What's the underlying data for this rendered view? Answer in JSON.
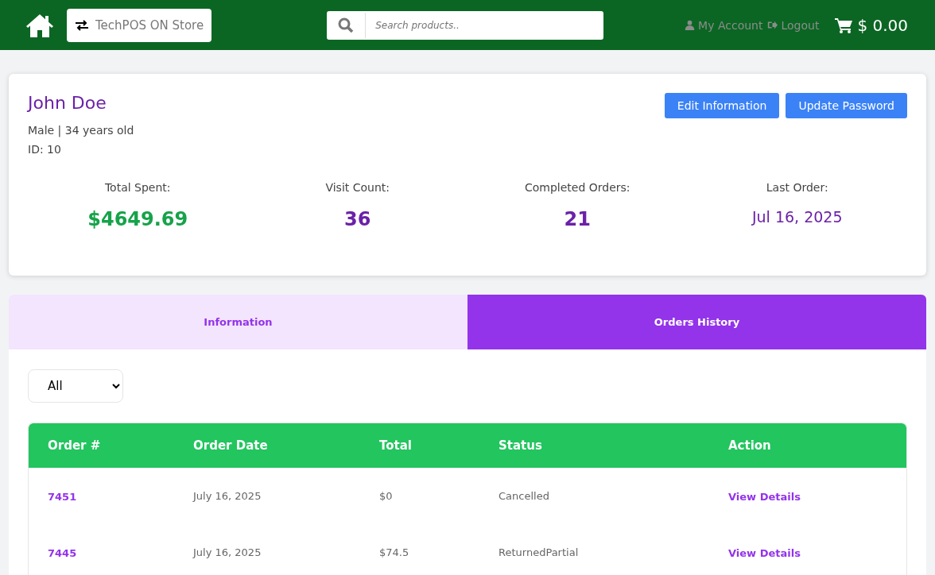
{
  "header": {
    "store": "TechPOS ON Store",
    "search": {
      "placeholder": "Search products.."
    },
    "links": [
      "My Account",
      "Logout"
    ],
    "cart_total": "$ 0.00"
  },
  "customer": {
    "name": "John Doe",
    "details": "Male | 34 years old",
    "id": "ID: 10",
    "buttons": [
      "Edit Information",
      "Update Password"
    ],
    "stats": [
      {
        "label": "Total Spent:",
        "value": "$4649.69",
        "kind": "money"
      },
      {
        "label": "Visit Count:",
        "value": "36",
        "kind": "count"
      },
      {
        "label": "Completed Orders:",
        "value": "21",
        "kind": "count"
      },
      {
        "label": "Last Order:",
        "value": "Jul 16, 2025",
        "kind": "date"
      }
    ]
  },
  "tabs": [
    {
      "label": "Information",
      "selected": false
    },
    {
      "label": "Orders History",
      "selected": true
    }
  ],
  "filter": {
    "value": "All"
  },
  "table": {
    "columns": [
      "Order #",
      "Order Date",
      "Total",
      "Status",
      "Action"
    ],
    "rows": [
      {
        "order": "7451",
        "date": "July 16, 2025",
        "total": "$0",
        "status": "Cancelled",
        "action": "View Details"
      },
      {
        "order": "7445",
        "date": "July 16, 2025",
        "total": "$74.5",
        "status": "ReturnedPartial",
        "action": "View Details"
      }
    ]
  }
}
